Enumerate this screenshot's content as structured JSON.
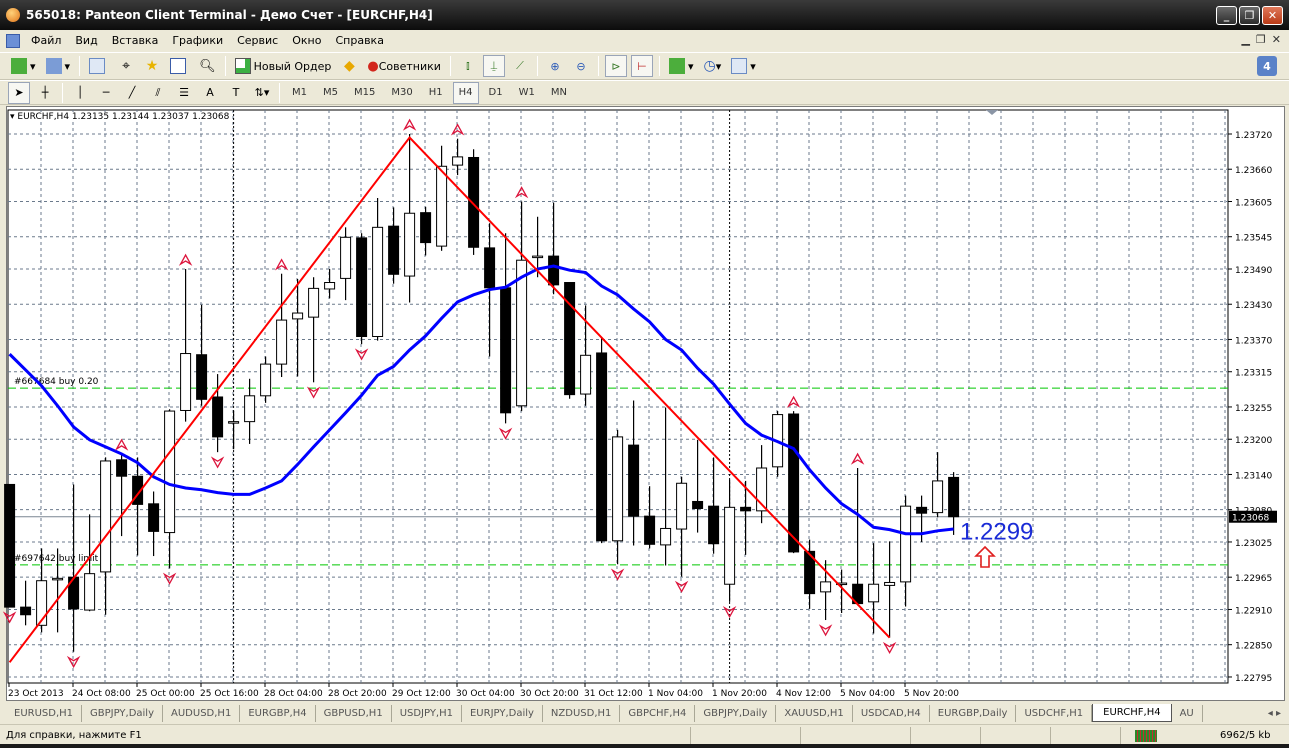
{
  "window": {
    "title": "565018: Panteon Client Terminal - Демо Счет - [EURCHF,H4]"
  },
  "menu": [
    "Файл",
    "Вид",
    "Вставка",
    "Графики",
    "Сервис",
    "Окно",
    "Справка"
  ],
  "toolbar": {
    "new_order": "Новый Ордер",
    "experts": "Советники",
    "alert_badge": "4"
  },
  "timeframes": [
    {
      "label": "M1",
      "active": false
    },
    {
      "label": "M5",
      "active": false
    },
    {
      "label": "M15",
      "active": false
    },
    {
      "label": "M30",
      "active": false
    },
    {
      "label": "H1",
      "active": false
    },
    {
      "label": "H4",
      "active": true
    },
    {
      "label": "D1",
      "active": false
    },
    {
      "label": "W1",
      "active": false
    },
    {
      "label": "MN",
      "active": false
    }
  ],
  "chart_header": "EURCHF,H4  1.23135 1.23144 1.23037 1.23068",
  "chart_data": {
    "type": "candlestick",
    "symbol": "EURCHF",
    "timeframe": "H4",
    "ylim": [
      1.22795,
      1.2372
    ],
    "price_ticks": [
      "1.23720",
      "1.23660",
      "1.23605",
      "1.23545",
      "1.23490",
      "1.23430",
      "1.23370",
      "1.23315",
      "1.23255",
      "1.23200",
      "1.23140",
      "1.23080",
      "1.23025",
      "1.22965",
      "1.22910",
      "1.22850",
      "1.22795"
    ],
    "current_price": "1.23068",
    "time_labels": [
      "23 Oct 2013",
      "24 Oct 08:00",
      "25 Oct 00:00",
      "25 Oct 16:00",
      "28 Oct 04:00",
      "28 Oct 20:00",
      "29 Oct 12:00",
      "30 Oct 04:00",
      "30 Oct 20:00",
      "31 Oct 12:00",
      "1 Nov 04:00",
      "1 Nov 20:00",
      "4 Nov 12:00",
      "5 Nov 04:00",
      "5 Nov 20:00"
    ],
    "ohlc": [
      [
        1.23123,
        1.23123,
        1.22914,
        1.22914
      ],
      [
        1.22914,
        1.22959,
        1.22883,
        1.22901
      ],
      [
        1.22883,
        1.23014,
        1.22871,
        1.22959
      ],
      [
        1.22963,
        1.23014,
        1.22871,
        1.22963
      ],
      [
        1.22965,
        1.23123,
        1.22838,
        1.22911
      ],
      [
        1.22909,
        1.23072,
        1.22907,
        1.22971
      ],
      [
        1.22974,
        1.23169,
        1.22901,
        1.23163
      ],
      [
        1.23165,
        1.23175,
        1.23035,
        1.23137
      ],
      [
        1.23137,
        1.23169,
        1.23002,
        1.23089
      ],
      [
        1.2309,
        1.23111,
        1.23001,
        1.23043
      ],
      [
        1.23041,
        1.23251,
        1.2298,
        1.23248
      ],
      [
        1.23249,
        1.2349,
        1.2323,
        1.23346
      ],
      [
        1.23344,
        1.23429,
        1.23257,
        1.23268
      ],
      [
        1.23272,
        1.23311,
        1.23178,
        1.23204
      ],
      [
        1.2323,
        1.23248,
        1.23183,
        1.2323
      ],
      [
        1.2323,
        1.23303,
        1.23192,
        1.23274
      ],
      [
        1.23274,
        1.23341,
        1.23262,
        1.23328
      ],
      [
        1.23328,
        1.23482,
        1.23306,
        1.23403
      ],
      [
        1.23405,
        1.23473,
        1.23307,
        1.23415
      ],
      [
        1.23408,
        1.23476,
        1.23297,
        1.23457
      ],
      [
        1.23456,
        1.2349,
        1.2344,
        1.23467
      ],
      [
        1.23474,
        1.23561,
        1.23437,
        1.23544
      ],
      [
        1.23543,
        1.23551,
        1.23362,
        1.23375
      ],
      [
        1.23375,
        1.23611,
        1.23368,
        1.23561
      ],
      [
        1.23563,
        1.23595,
        1.23465,
        1.23481
      ],
      [
        1.23478,
        1.2372,
        1.23433,
        1.23585
      ],
      [
        1.23586,
        1.23596,
        1.23513,
        1.23535
      ],
      [
        1.23529,
        1.237,
        1.23521,
        1.23665
      ],
      [
        1.23667,
        1.23712,
        1.2365,
        1.23681
      ],
      [
        1.2368,
        1.23694,
        1.23514,
        1.23527
      ],
      [
        1.23526,
        1.23568,
        1.23341,
        1.23458
      ],
      [
        1.23458,
        1.23551,
        1.23227,
        1.23245
      ],
      [
        1.23257,
        1.23605,
        1.23248,
        1.23505
      ],
      [
        1.23512,
        1.23579,
        1.23476,
        1.23512
      ],
      [
        1.23512,
        1.23603,
        1.23447,
        1.23463
      ],
      [
        1.23467,
        1.23467,
        1.23269,
        1.23276
      ],
      [
        1.23277,
        1.23428,
        1.23257,
        1.23343
      ],
      [
        1.23347,
        1.23372,
        1.23023,
        1.23027
      ],
      [
        1.23027,
        1.23216,
        1.22987,
        1.23204
      ],
      [
        1.2319,
        1.23266,
        1.23019,
        1.23069
      ],
      [
        1.23069,
        1.2312,
        1.23014,
        1.23021
      ],
      [
        1.2302,
        1.23254,
        1.22985,
        1.23048
      ],
      [
        1.23047,
        1.23136,
        1.22966,
        1.23125
      ],
      [
        1.23094,
        1.23199,
        1.23041,
        1.23082
      ],
      [
        1.23086,
        1.23169,
        1.23005,
        1.23022
      ],
      [
        1.22953,
        1.23131,
        1.22923,
        1.23084
      ],
      [
        1.23084,
        1.23129,
        1.23003,
        1.23078
      ],
      [
        1.23078,
        1.2319,
        1.23057,
        1.23151
      ],
      [
        1.23153,
        1.23248,
        1.23136,
        1.23242
      ],
      [
        1.23243,
        1.23248,
        1.23006,
        1.23008
      ],
      [
        1.23009,
        1.23029,
        1.22911,
        1.22937
      ],
      [
        1.2294,
        1.22994,
        1.22892,
        1.22957
      ],
      [
        1.22955,
        1.22978,
        1.22904,
        1.22955
      ],
      [
        1.22953,
        1.23151,
        1.22917,
        1.2292
      ],
      [
        1.22923,
        1.23023,
        1.22869,
        1.22953
      ],
      [
        1.22951,
        1.23026,
        1.22862,
        1.22956
      ],
      [
        1.22957,
        1.23104,
        1.22915,
        1.23086
      ],
      [
        1.23084,
        1.23104,
        1.23025,
        1.23074
      ],
      [
        1.23075,
        1.23178,
        1.23067,
        1.23129
      ],
      [
        1.23135,
        1.23144,
        1.23037,
        1.23068
      ]
    ],
    "moving_average": [
      1.23345,
      1.23318,
      1.23291,
      1.23257,
      1.23221,
      1.23199,
      1.23187,
      1.23175,
      1.2316,
      1.23136,
      1.23123,
      1.23117,
      1.23114,
      1.23109,
      1.23106,
      1.23106,
      1.23117,
      1.23129,
      1.23157,
      1.23187,
      1.23216,
      1.23245,
      1.23275,
      1.23309,
      1.23324,
      1.23352,
      1.23376,
      1.23406,
      1.23434,
      1.23446,
      1.23455,
      1.23459,
      1.23476,
      1.2349,
      1.23495,
      1.23488,
      1.23484,
      1.23461,
      1.23446,
      1.23422,
      1.234,
      1.2337,
      1.23352,
      1.23321,
      1.23294,
      1.2326,
      1.23227,
      1.23207,
      1.23196,
      1.23184,
      1.23148,
      1.23117,
      1.2309,
      1.23072,
      1.2305,
      1.23046,
      1.23039,
      1.23039,
      1.23044,
      1.23047
    ],
    "zigzag": [
      {
        "bar": 0,
        "price": 1.2282
      },
      {
        "bar": 25,
        "price": 1.23714
      },
      {
        "bar": 55,
        "price": 1.22862
      }
    ],
    "fractals_up": [
      7,
      11,
      17,
      25,
      28,
      32,
      49,
      53
    ],
    "fractals_down": [
      0,
      4,
      10,
      13,
      19,
      22,
      31,
      38,
      42,
      45,
      51,
      55
    ],
    "period_separators": [
      14,
      45
    ],
    "order_lines": [
      {
        "label": "#667684 buy 0.20",
        "price": 1.23287
      },
      {
        "label": "#697642 buy limit 0",
        "price": 1.22986
      }
    ],
    "annotation": {
      "text": "1.2299",
      "color": "#1a2bd6"
    },
    "colors": {
      "ma": "#0000ff",
      "zigzag": "#ff0000",
      "fractal": "#dc143c",
      "order": "#00c800",
      "grid": "#6b7a8c"
    }
  },
  "symbol_tabs": [
    {
      "label": "EURUSD,H1",
      "active": false
    },
    {
      "label": "GBPJPY,Daily",
      "active": false
    },
    {
      "label": "AUDUSD,H1",
      "active": false
    },
    {
      "label": "EURGBP,H4",
      "active": false
    },
    {
      "label": "GBPUSD,H1",
      "active": false
    },
    {
      "label": "USDJPY,H1",
      "active": false
    },
    {
      "label": "EURJPY,Daily",
      "active": false
    },
    {
      "label": "NZDUSD,H1",
      "active": false
    },
    {
      "label": "GBPCHF,H4",
      "active": false
    },
    {
      "label": "GBPJPY,Daily",
      "active": false
    },
    {
      "label": "XAUUSD,H1",
      "active": false
    },
    {
      "label": "USDCAD,H4",
      "active": false
    },
    {
      "label": "EURGBP,Daily",
      "active": false
    },
    {
      "label": "USDCHF,H1",
      "active": false
    },
    {
      "label": "EURCHF,H4",
      "active": true
    },
    {
      "label": "AU",
      "active": false
    }
  ],
  "status": {
    "help": "Для справки, нажмите F1",
    "traffic": "6962/5 kb"
  }
}
